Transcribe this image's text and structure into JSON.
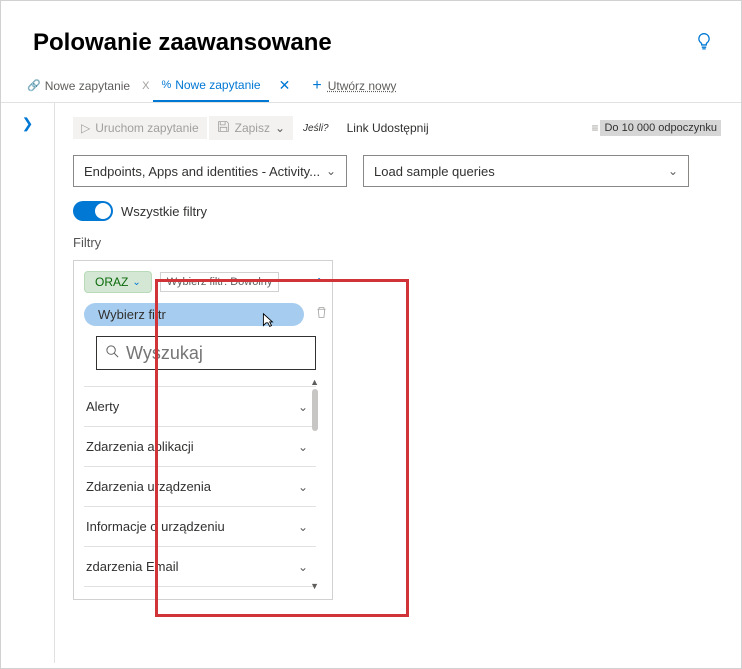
{
  "header": {
    "title": "Polowanie zaawansowane"
  },
  "tabs": {
    "items": [
      {
        "label": "Nowe zapytanie"
      },
      {
        "label": "Nowe zapytanie"
      }
    ],
    "new_label": "Utwórz nowy"
  },
  "toolbar": {
    "run": "Uruchom zapytanie",
    "save": "Zapisz",
    "if": "Jeśli?",
    "share": "Link Udostępnij",
    "limit": "Do 10 000 odpoczynku"
  },
  "selects": {
    "domain": "Endpoints, Apps and identities - Activity...",
    "sample": "Load sample queries"
  },
  "toggle": {
    "label": "Wszystkie filtry"
  },
  "filters": {
    "label": "Filtry",
    "logic": "ORAZ",
    "any": "Wybierz filtr: Dowolny",
    "select_filter": "Wybierz filtr"
  },
  "search": {
    "placeholder": "Wyszukaj"
  },
  "categories": [
    "Alerty",
    "Zdarzenia aplikacji",
    "Zdarzenia urządzenia",
    "Informacje o urządzeniu",
    "zdarzenia Email"
  ]
}
